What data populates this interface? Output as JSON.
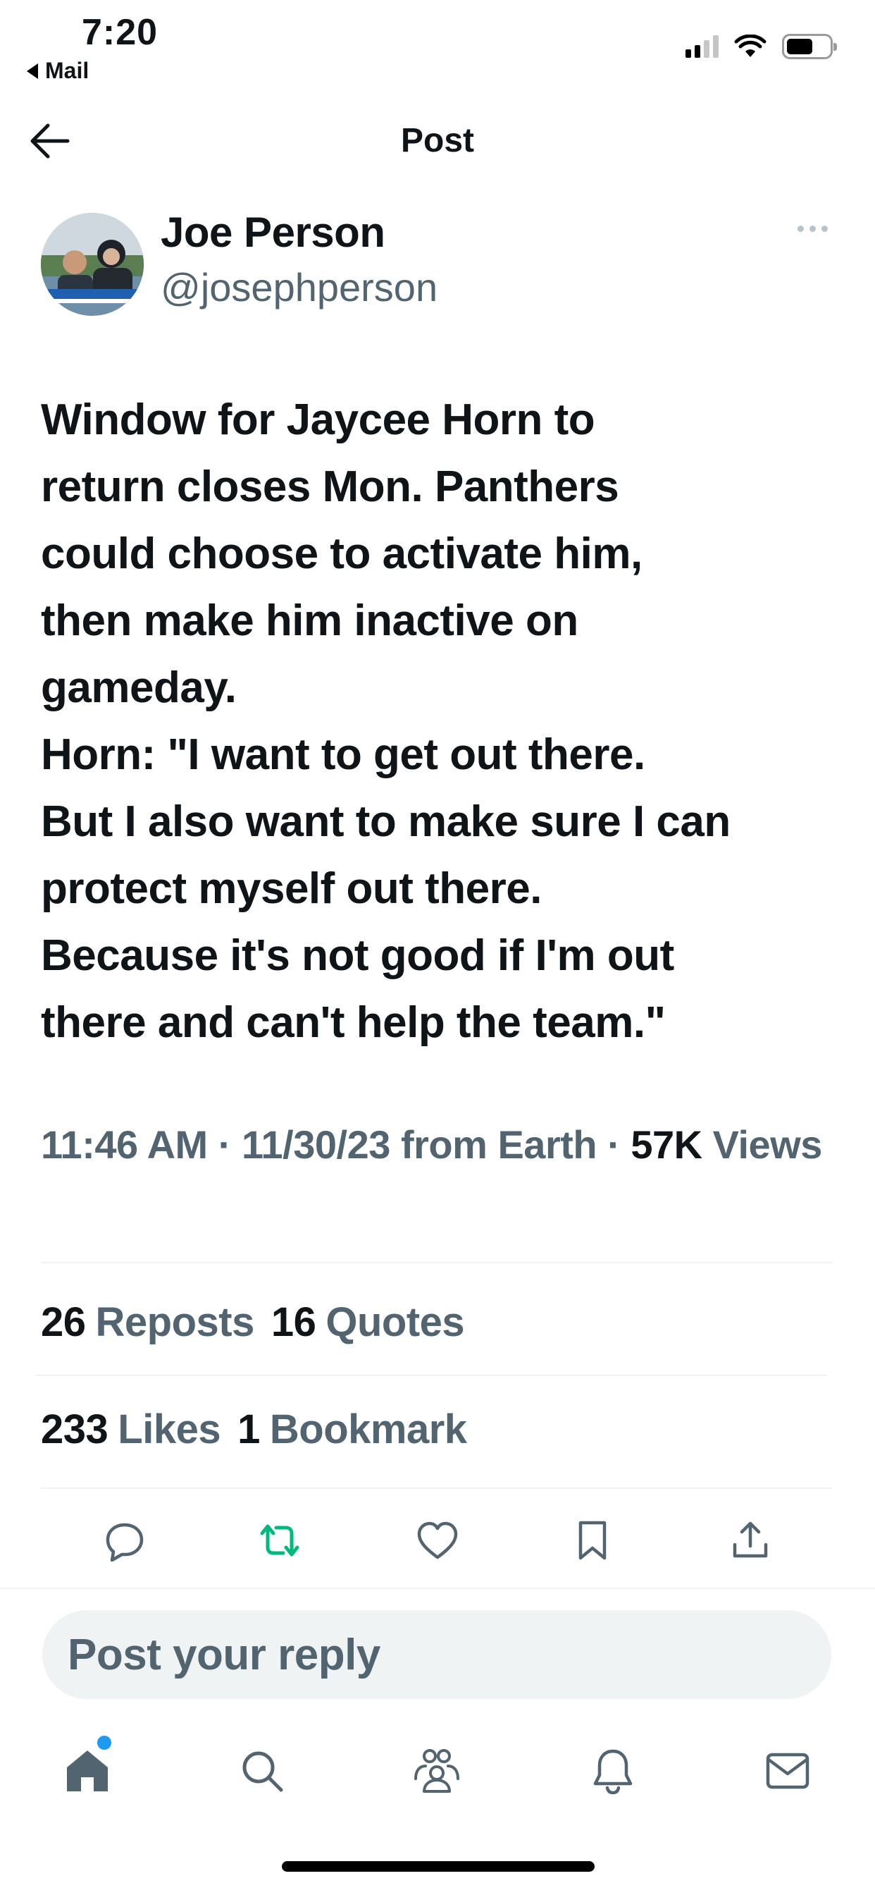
{
  "status_bar": {
    "time": "7:20",
    "back_app": "Mail"
  },
  "header": {
    "title": "Post"
  },
  "author": {
    "display_name": "Joe Person",
    "handle": "@josephperson"
  },
  "tweet": {
    "text": "Window for Jaycee Horn to\nreturn closes Mon. Panthers\ncould choose to activate him,\nthen make him inactive on\ngameday.\nHorn: \"I want to get out there.\nBut I also want to make sure I can\nprotect myself out there.\nBecause it's not good if I'm out\nthere and can't help the team.\""
  },
  "meta": {
    "time": "11:46 AM",
    "sep1": " · ",
    "date": "11/30/23",
    "source": " from Earth",
    "sep2": " · ",
    "views_count": "57K",
    "views_label": " Views"
  },
  "stats": {
    "reposts_count": "26",
    "reposts_label": "Reposts",
    "quotes_count": "16",
    "quotes_label": "Quotes",
    "likes_count": "233",
    "likes_label": "Likes",
    "bookmarks_count": "1",
    "bookmarks_label": "Bookmark"
  },
  "actions": [
    {
      "icon": "reply-icon"
    },
    {
      "icon": "repost-icon",
      "color": "#00ba7c"
    },
    {
      "icon": "like-icon"
    },
    {
      "icon": "bookmark-icon"
    },
    {
      "icon": "share-icon"
    }
  ],
  "reply": {
    "placeholder": "Post your reply"
  },
  "tab_bar": [
    {
      "icon": "home-icon",
      "active": true,
      "has_notification_dot": true,
      "dot_color": "#1d9bf0"
    },
    {
      "icon": "search-icon"
    },
    {
      "icon": "communities-icon"
    },
    {
      "icon": "notifications-icon"
    },
    {
      "icon": "messages-icon"
    }
  ],
  "colors": {
    "text": "#0f1419",
    "secondary": "#536471",
    "divider": "#eff3f4",
    "accent": "#1d9bf0",
    "repost_green": "#00ba7c"
  }
}
